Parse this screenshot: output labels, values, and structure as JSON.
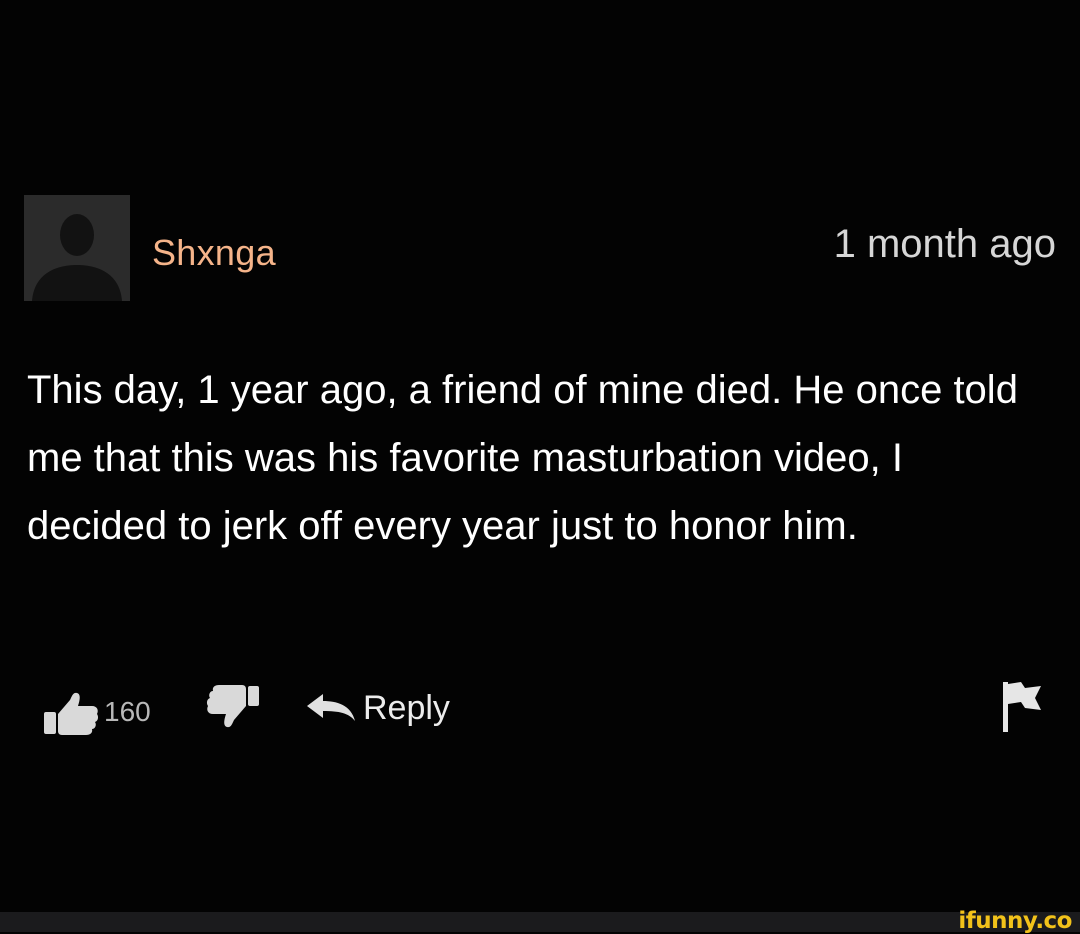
{
  "comment": {
    "username": "Shxnga",
    "timestamp": "1 month ago",
    "text": "This day, 1 year ago, a friend of mine died. He once told me that this was his favorite masturbation video, I decided to jerk off every year just to honor him.",
    "colors": {
      "username": "#f5b48a",
      "text": "#ffffff",
      "background": "#030303"
    },
    "avatar_icon": "default-user-silhouette-icon"
  },
  "actions": {
    "like_count": "160",
    "like_icon": "thumbs-up-icon",
    "dislike_icon": "thumbs-down-icon",
    "reply_icon": "reply-arrow-icon",
    "reply_label": "Reply",
    "flag_icon": "flag-icon"
  },
  "footer": {
    "watermark": "ifunny.co",
    "watermark_color": "#f2c21a"
  }
}
